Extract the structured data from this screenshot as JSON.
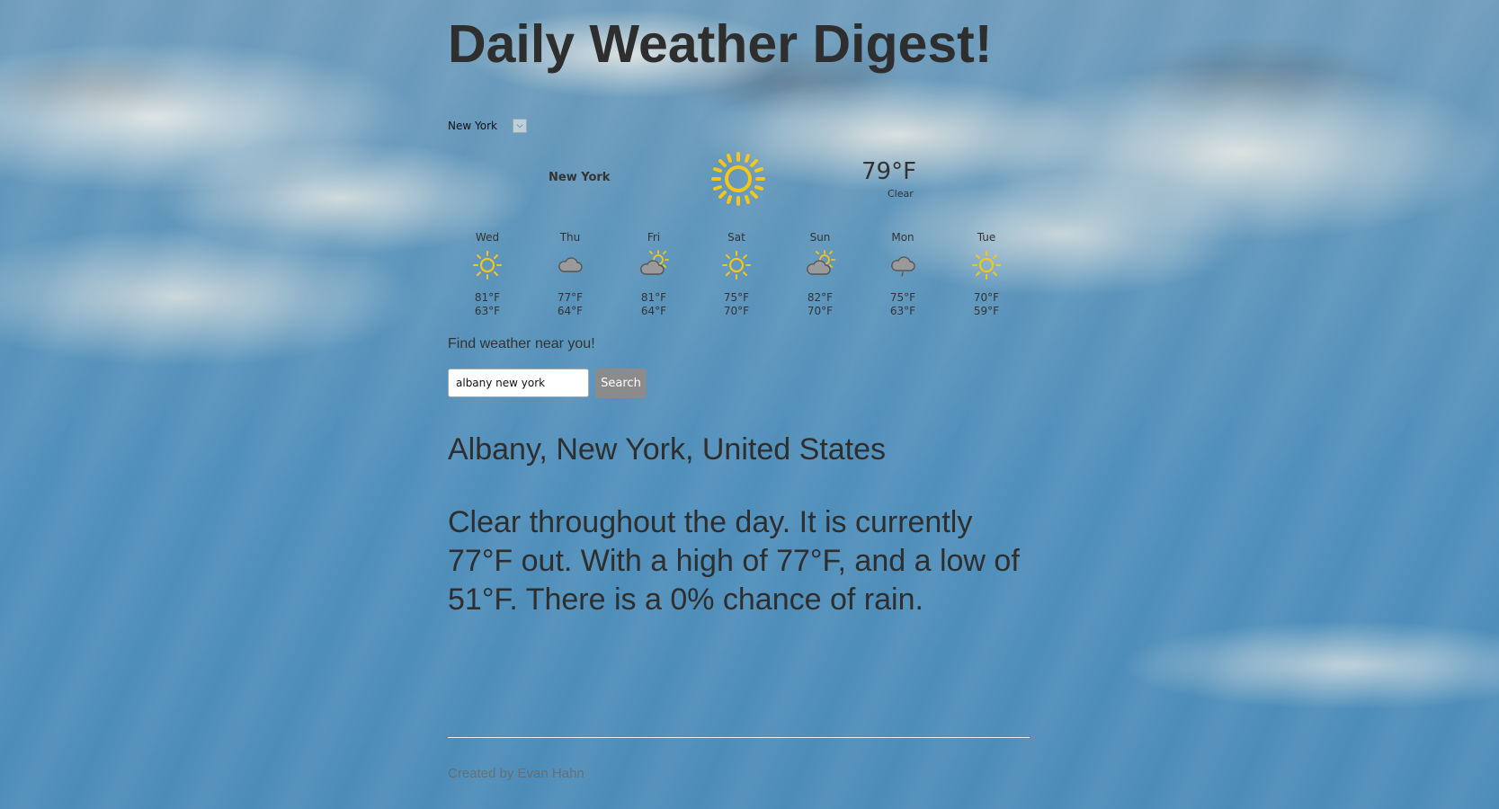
{
  "header": {
    "title": "Daily Weather Digest!"
  },
  "city_select": {
    "selected": "New York",
    "arrow_icon": "chevron-down-icon"
  },
  "current": {
    "city": "New York",
    "icon": "sun-icon",
    "temp": "79°F",
    "condition": "Clear"
  },
  "forecast": [
    {
      "day": "Wed",
      "icon": "sun-icon",
      "high": "81°F",
      "low": "63°F"
    },
    {
      "day": "Thu",
      "icon": "cloud-icon",
      "high": "77°F",
      "low": "64°F"
    },
    {
      "day": "Fri",
      "icon": "partly-cloudy-icon",
      "high": "81°F",
      "low": "64°F"
    },
    {
      "day": "Sat",
      "icon": "sun-icon",
      "high": "75°F",
      "low": "70°F"
    },
    {
      "day": "Sun",
      "icon": "partly-cloudy-icon",
      "high": "82°F",
      "low": "70°F"
    },
    {
      "day": "Mon",
      "icon": "rain-cloud-icon",
      "high": "75°F",
      "low": "63°F"
    },
    {
      "day": "Tue",
      "icon": "sun-icon",
      "high": "70°F",
      "low": "59°F"
    }
  ],
  "search": {
    "label": "Find weather near you!",
    "value": "albany new york",
    "button_label": "Search"
  },
  "result": {
    "place": "Albany, New York, United States",
    "description": "Clear throughout the day. It is currently 77°F out. With a high of 77°F, and a low of 51°F. There is a 0% chance of rain."
  },
  "footer": {
    "credit": "Created by Evan Hahn"
  },
  "colors": {
    "sun": "#f5c518",
    "cloud": "#9a9a9a",
    "text": "#333333",
    "button": "#8b8b8b"
  }
}
